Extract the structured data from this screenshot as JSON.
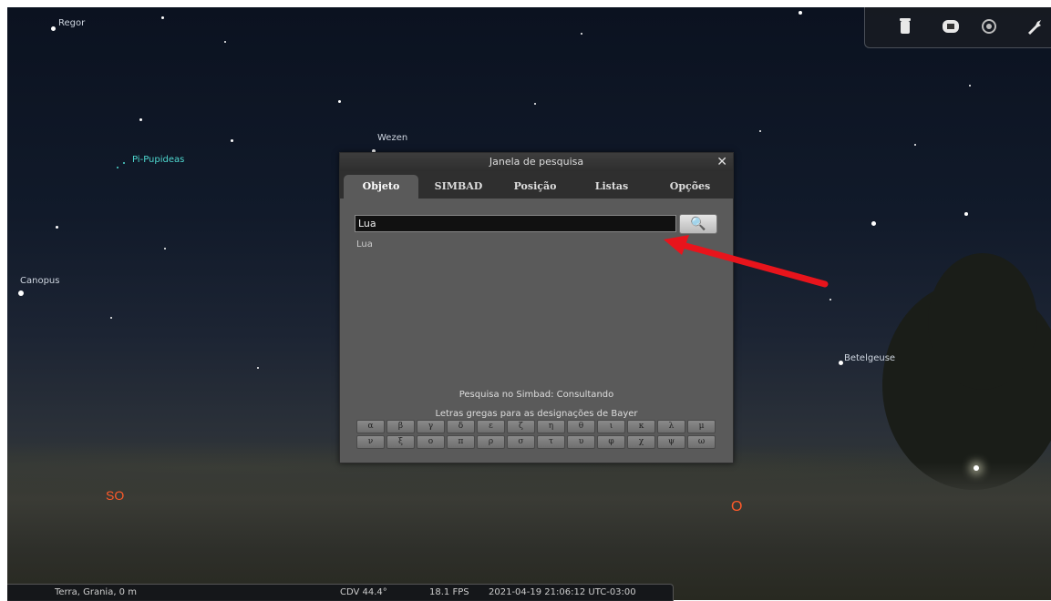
{
  "sky_labels": {
    "regor": "Regor",
    "wezen": "Wezen",
    "pi_pupideas": "Pi-Pupideas",
    "canopus": "Canopus",
    "betelgeuse": "Betelgeuse"
  },
  "cardinals": {
    "so": "SO",
    "o": "O"
  },
  "dialog": {
    "title": "Janela de pesquisa",
    "close": "✕",
    "tabs": [
      "Objeto",
      "SIMBAD",
      "Posição",
      "Listas",
      "Opções"
    ],
    "search_value": "Lua",
    "search_button_icon": "🔍",
    "result": "Lua",
    "simbad_status": "Pesquisa no Simbad: Consultando",
    "greek_title": "Letras gregas para as designações de Bayer",
    "greek_row1": [
      "α",
      "β",
      "γ",
      "δ",
      "ε",
      "ζ",
      "η",
      "θ",
      "ι",
      "κ",
      "λ",
      "μ"
    ],
    "greek_row2": [
      "ν",
      "ξ",
      "ο",
      "π",
      "ρ",
      "σ",
      "τ",
      "υ",
      "φ",
      "χ",
      "ψ",
      "ω"
    ]
  },
  "statusbar": {
    "location": "Terra, Grania, 0 m",
    "fov": "CDV 44.4°",
    "fps": "18.1 FPS",
    "datetime": "2021-04-19 21:06:12 UTC-03:00"
  },
  "toolbar_icons": [
    "trash-icon",
    "screenshot-icon",
    "settings-icon",
    "wrench-icon"
  ],
  "colors": {
    "cardinal": "#ff5a2a",
    "arrow": "#e8141c",
    "highlight_label": "#4fd8d0"
  }
}
